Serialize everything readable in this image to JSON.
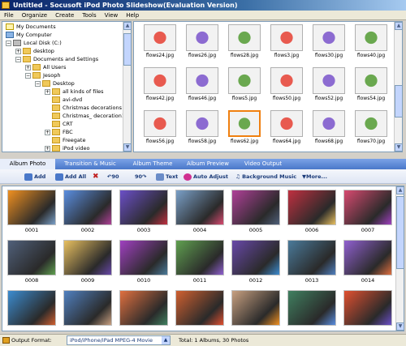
{
  "window": {
    "title": "Untitled - Socusoft iPod Photo Slideshow(Evaluation Version)"
  },
  "menu": [
    "File",
    "Organize",
    "Create",
    "Tools",
    "View",
    "Help"
  ],
  "tree": [
    {
      "label": "My Documents",
      "icon": "document-folder-icon"
    },
    {
      "label": "My Computer",
      "icon": "computer-icon"
    },
    {
      "label": "Local Disk (C:)",
      "icon": "drive-icon"
    },
    {
      "label": "desktop",
      "icon": "folder-icon"
    },
    {
      "label": "Documents and Settings",
      "icon": "folder-icon"
    },
    {
      "label": "All Users",
      "icon": "folder-icon"
    },
    {
      "label": "Jesoph",
      "icon": "folder-icon"
    },
    {
      "label": "Desktop",
      "icon": "folder-icon"
    },
    {
      "label": "all kinds of files",
      "icon": "folder-icon"
    },
    {
      "label": "avi-dvd",
      "icon": "folder-icon"
    },
    {
      "label": "Christmas decorations",
      "icon": "folder-icon"
    },
    {
      "label": "Christmas_ decoration1ddd",
      "icon": "folder-icon"
    },
    {
      "label": "CRT",
      "icon": "folder-icon"
    },
    {
      "label": "FBC",
      "icon": "folder-icon"
    },
    {
      "label": "Freegate",
      "icon": "folder-icon"
    },
    {
      "label": "iPod video",
      "icon": "folder-icon"
    }
  ],
  "browser_files": [
    "flows24.jpg",
    "flows26.jpg",
    "flows28.jpg",
    "flows3.jpg",
    "flows30.jpg",
    "flows40.jpg",
    "flows42.jpg",
    "flows46.jpg",
    "flows5.jpg",
    "flows50.jpg",
    "flows52.jpg",
    "flows54.jpg",
    "flows56.jpg",
    "flows58.jpg",
    "flows62.jpg",
    "flows64.jpg",
    "flows68.jpg",
    "flows70.jpg"
  ],
  "browser_selected": "flows62.jpg",
  "tabs": [
    "Album Photo",
    "Transition & Music",
    "Album Theme",
    "Album Preview",
    "Video Output"
  ],
  "active_tab": "Album Photo",
  "toolbar": {
    "add": "Add",
    "add_all": "Add All",
    "rotate_left": "90",
    "rotate_right": "90",
    "text": "Text",
    "auto_adjust": "Auto Adjust",
    "background_music": "Background Music",
    "more": "More..."
  },
  "album_photos": [
    "0001",
    "0002",
    "0003",
    "0004",
    "0005",
    "0006",
    "0007",
    "0008",
    "0009",
    "0010",
    "0011",
    "0012",
    "0013",
    "0014",
    "",
    "",
    "",
    "",
    "",
    "",
    ""
  ],
  "status": {
    "output_label": "Output Format:",
    "output_value": "iPod/iPhone/iPad MPEG-4 Movie",
    "total": "Total: 1 Albums, 30 Photos"
  },
  "colors": {
    "accent": "#3a6ea5",
    "tab_bar": "#4a78c9",
    "selection": "#f08010"
  }
}
